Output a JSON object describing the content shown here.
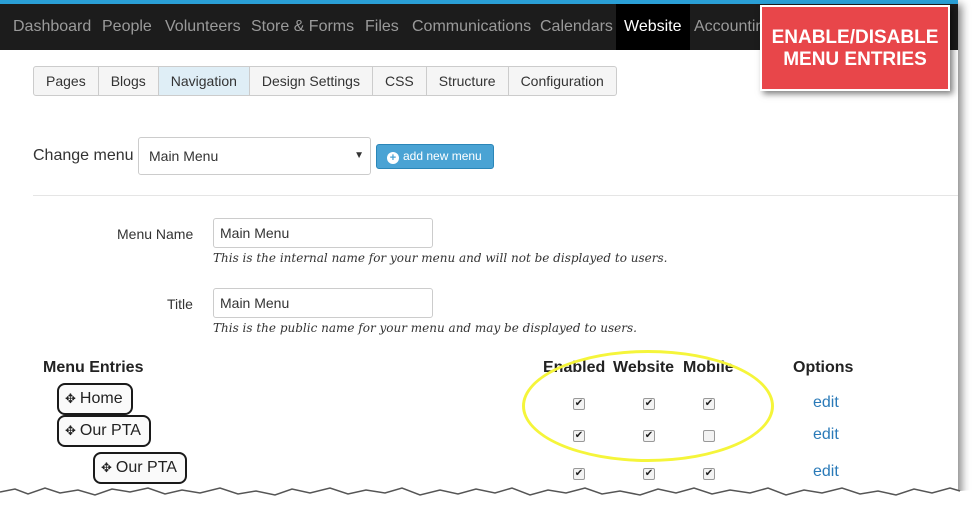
{
  "topnav": {
    "items": [
      "Dashboard",
      "People",
      "Volunteers",
      "Store & Forms",
      "Files",
      "Communications",
      "Calendars",
      "Website",
      "Accounting"
    ],
    "active": "Website"
  },
  "callout": {
    "line1": "ENABLE/DISABLE",
    "line2": "MENU ENTRIES"
  },
  "tabs": [
    "Pages",
    "Blogs",
    "Navigation",
    "Design Settings",
    "CSS",
    "Structure",
    "Configuration"
  ],
  "change_menu": {
    "label": "Change menu",
    "selected": "Main Menu",
    "add_button": "add new menu"
  },
  "menu_name": {
    "label": "Menu Name",
    "value": "Main Menu",
    "help": "This is the internal name for your menu and will not be displayed to users."
  },
  "title": {
    "label": "Title",
    "value": "Main Menu",
    "help": "This is the public name for your menu and may be displayed to users."
  },
  "table": {
    "headers": {
      "entries": "Menu Entries",
      "enabled": "Enabled",
      "website": "Website",
      "mobile": "Mobile",
      "options": "Options"
    },
    "rows": [
      {
        "label": "Home",
        "enabled": true,
        "website": true,
        "mobile": true,
        "option": "edit"
      },
      {
        "label": "Our PTA",
        "enabled": true,
        "website": true,
        "mobile": false,
        "option": "edit"
      },
      {
        "label": "Our PTA",
        "enabled": true,
        "website": true,
        "mobile": true,
        "option": "edit"
      }
    ]
  },
  "colors": {
    "nav_bg": "#1c1c1c",
    "accent": "#2a9fd6",
    "callout": "#e8464a",
    "highlight": "#f5f53a",
    "link": "#2a7ab8"
  }
}
